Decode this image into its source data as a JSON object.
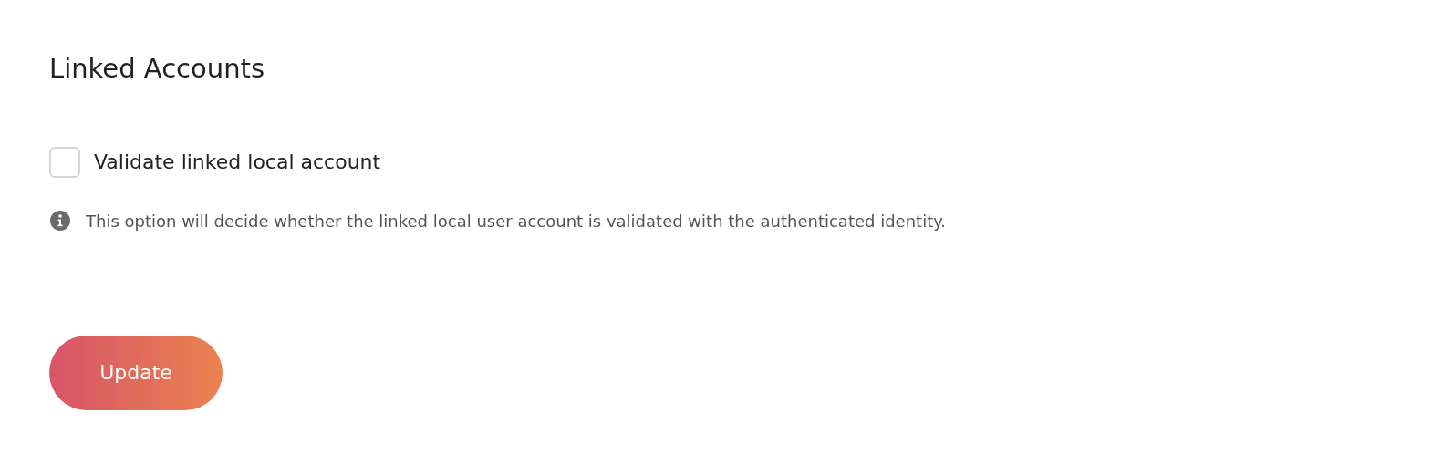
{
  "title": "Linked Accounts",
  "checkbox": {
    "label": "Validate linked local account",
    "checked": false
  },
  "hint": "This option will decide whether the linked local user account is validated with the authenticated identity.",
  "buttons": [
    "Update"
  ]
}
